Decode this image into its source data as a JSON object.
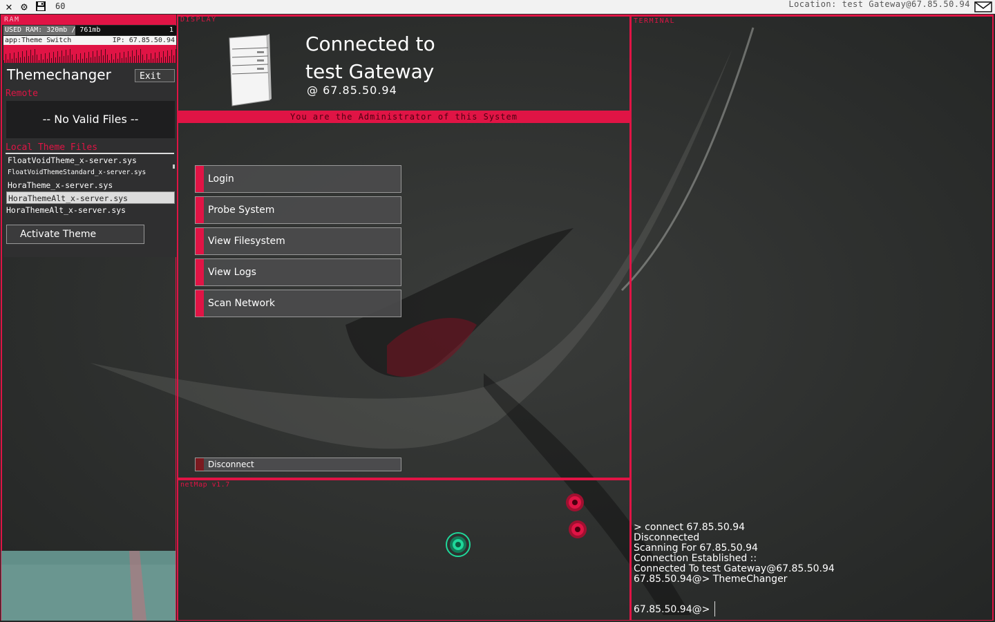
{
  "topbar": {
    "icons": [
      "close-icon",
      "gear-icon",
      "save-icon"
    ],
    "fps": "60",
    "location": "Location: test Gateway@67.85.50.94",
    "mail_icon": "mail-icon"
  },
  "ram": {
    "title": "RAM",
    "used": "USED RAM: 320mb / 761mb",
    "count": "1",
    "app_name": "app:Theme Switch",
    "app_ip": "IP: 67.85.50.94",
    "app_title": "Themechanger",
    "exit_label": "Exit",
    "remote_label": "Remote",
    "no_files": "-- No Valid Files --",
    "local_label": "Local Theme Files",
    "files": [
      "FloatVoidTheme_x-server.sys",
      "FloatVoidThemeStandard_x-server.sys",
      "HoraTheme_x-server.sys",
      "HoraThemeAlt_x-server.sys",
      "HoraThemeAlt_x-server.sys"
    ],
    "selected_file_index": 3,
    "activate_label": "Activate Theme"
  },
  "display": {
    "title": "DISPLAY",
    "connected_line1": "Connected to",
    "connected_line2": "test Gateway",
    "connected_ip": "@  67.85.50.94",
    "admin_notice": "You are the Administrator of this System",
    "menu": [
      "Login",
      "Probe System",
      "View Filesystem",
      "View Logs",
      "Scan Network"
    ],
    "disconnect_label": "Disconnect"
  },
  "netmap": {
    "title": "netMap v1.7",
    "nodes": [
      {
        "type": "home",
        "color": "#1fd89a"
      },
      {
        "type": "remote",
        "color": "#e01445"
      },
      {
        "type": "remote",
        "color": "#e01445"
      }
    ]
  },
  "terminal": {
    "title": "TERMINAL",
    "lines": [
      "> connect 67.85.50.94",
      "Disconnected",
      "Scanning For 67.85.50.94",
      "Connection Established ::",
      "Connected To test Gateway@67.85.50.94",
      "67.85.50.94@> ThemeChanger"
    ],
    "prompt": "67.85.50.94@>"
  },
  "colors": {
    "accent": "#e01445",
    "background": "#2b2d2c",
    "node_home": "#1fd89a"
  }
}
